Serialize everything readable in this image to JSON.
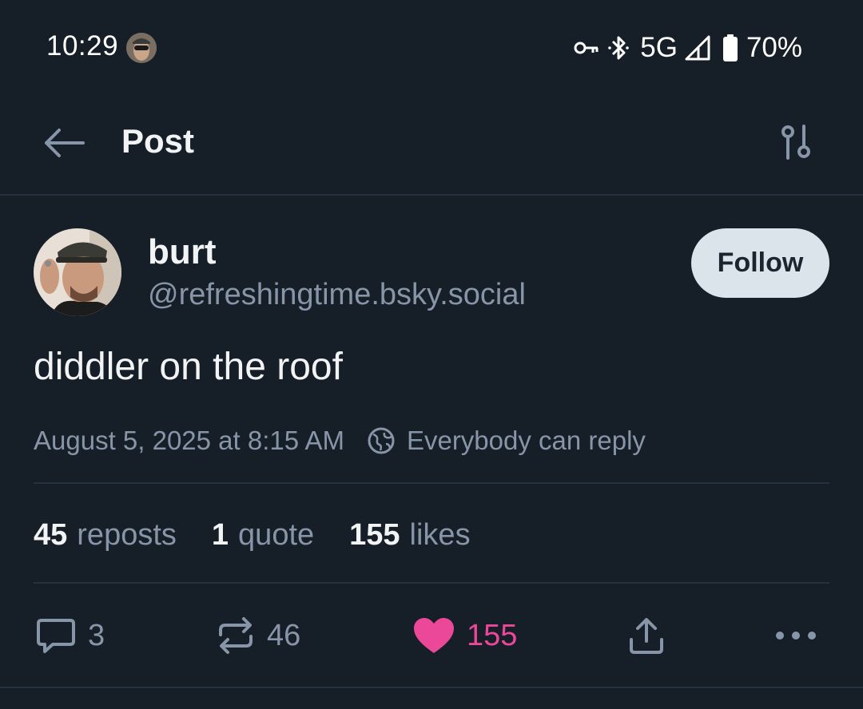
{
  "status_bar": {
    "time": "10:29",
    "network": "5G",
    "battery": "70%",
    "icons": [
      "vpn-key-icon",
      "bluetooth-icon",
      "signal-icon",
      "battery-icon"
    ]
  },
  "header": {
    "title": "Post",
    "back_icon": "arrow-left-icon",
    "settings_icon": "sliders-icon"
  },
  "post": {
    "author_name": "burt",
    "author_handle": "@refreshingtime.bsky.social",
    "follow_label": "Follow",
    "text": "diddler on the roof",
    "timestamp": "August 5, 2025 at 8:15 AM",
    "reply_setting": "Everybody can reply",
    "stats": {
      "reposts_count": "45",
      "reposts_label": "reposts",
      "quotes_count": "1",
      "quotes_label": "quote",
      "likes_count": "155",
      "likes_label": "likes"
    },
    "actions": {
      "replies": "3",
      "reposts": "46",
      "likes": "155"
    }
  },
  "colors": {
    "background": "#161e27",
    "muted_text": "#8795a8",
    "like_accent": "#ec4899",
    "follow_button_bg": "#dbe3eb"
  }
}
